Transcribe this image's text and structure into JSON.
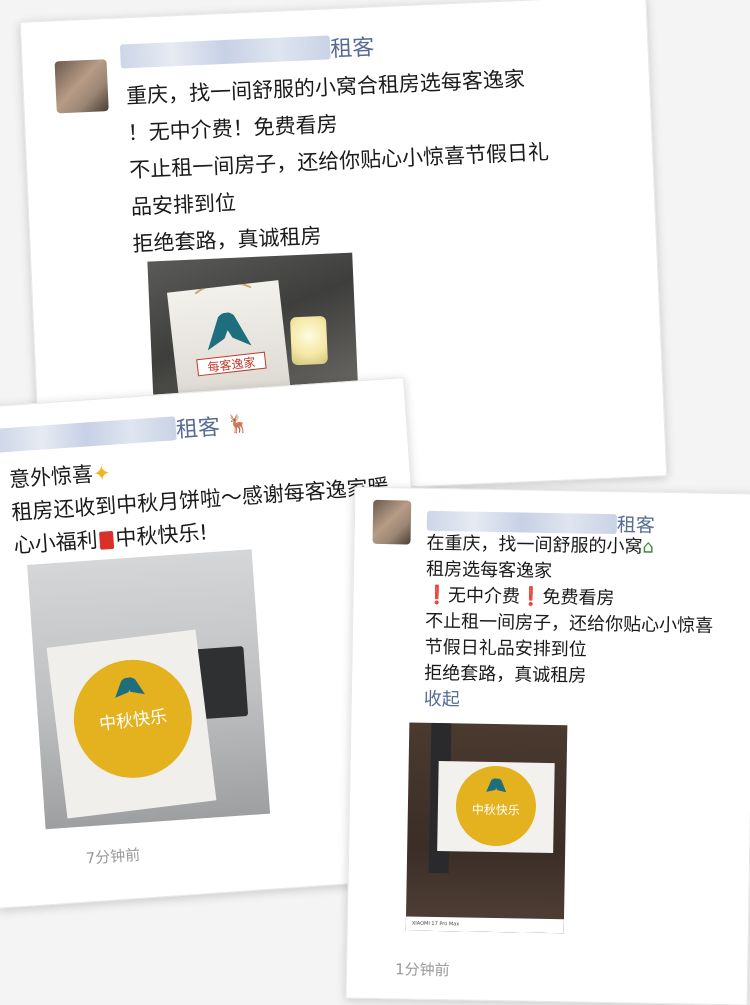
{
  "post1": {
    "name_suffix": "租客",
    "lines": [
      "重庆，找一间舒服的小窝合租房选每客逸家",
      "！无中介费！免费看房",
      "不止租一间房子，还给你贴心小惊喜节假日礼",
      "品安排到位",
      "拒绝套路，真诚租房"
    ],
    "photo_brand_text": "每客逸家"
  },
  "post2": {
    "name_suffix": "租客",
    "lines": [
      "意外惊喜",
      "租房还收到中秋月饼啦～感谢每客逸家暖",
      "心小福利",
      "中秋快乐!"
    ],
    "photo_label": "中秋快乐",
    "time": "7分钟前"
  },
  "post3": {
    "name_suffix": "租客",
    "lines": [
      "在重庆，找一间舒服的小窝",
      "租房选每客逸家",
      "无中介费",
      "免费看房",
      "不止租一间房子，还给你贴心小惊喜",
      "节假日礼品安排到位",
      "拒绝套路，真诚租房"
    ],
    "collapse_label": "收起",
    "photo_label": "中秋快乐",
    "photo_caption": "XIAOMI 17 Pro Max",
    "time": "1分钟前"
  },
  "colors": {
    "link": "#576b95",
    "gold": "#e3b21e",
    "brand": "#1e6e7e",
    "red": "#e2352b"
  }
}
